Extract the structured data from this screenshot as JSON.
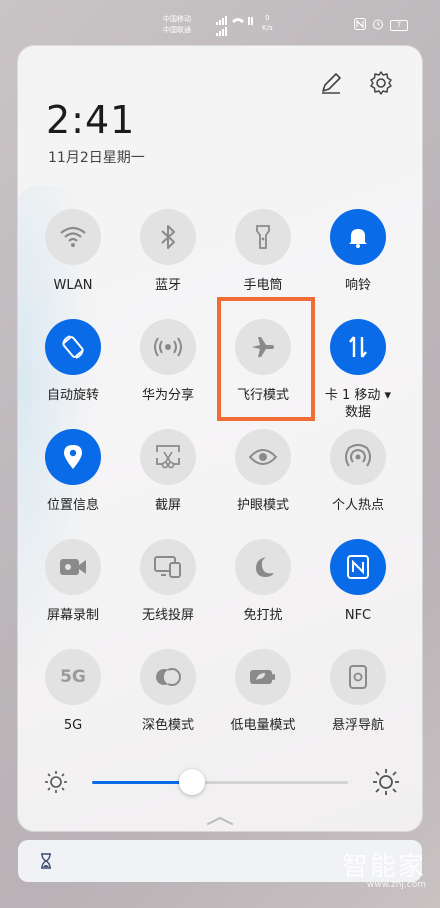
{
  "status_bar": {
    "carrier1": "中国移动",
    "carrier2": "中国联通",
    "speed_value": "0",
    "speed_unit": "K/s",
    "battery": "7"
  },
  "header": {
    "time": "2:41",
    "date": "11月2日星期一"
  },
  "tiles": [
    {
      "label": "WLAN",
      "icon": "wifi-icon",
      "on": false
    },
    {
      "label": "蓝牙",
      "icon": "bluetooth-icon",
      "on": false
    },
    {
      "label": "手电筒",
      "icon": "flashlight-icon",
      "on": false
    },
    {
      "label": "响铃",
      "icon": "bell-icon",
      "on": true
    },
    {
      "label": "自动旋转",
      "icon": "auto-rotate-icon",
      "on": true
    },
    {
      "label": "华为分享",
      "icon": "huawei-share-icon",
      "on": false
    },
    {
      "label": "飞行模式",
      "icon": "airplane-icon",
      "on": false
    },
    {
      "label": "卡 1 移动 ▾",
      "label2": "数据",
      "icon": "mobile-data-icon",
      "on": true
    },
    {
      "label": "位置信息",
      "icon": "location-icon",
      "on": true
    },
    {
      "label": "截屏",
      "icon": "screenshot-icon",
      "on": false
    },
    {
      "label": "护眼模式",
      "icon": "eye-icon",
      "on": false
    },
    {
      "label": "个人热点",
      "icon": "hotspot-icon",
      "on": false
    },
    {
      "label": "屏幕录制",
      "icon": "screen-record-icon",
      "on": false
    },
    {
      "label": "无线投屏",
      "icon": "wireless-projection-icon",
      "on": false
    },
    {
      "label": "免打扰",
      "icon": "moon-icon",
      "on": false
    },
    {
      "label": "NFC",
      "icon": "nfc-icon",
      "on": true
    },
    {
      "label": "5G",
      "icon": "5g-icon",
      "icon_text": "5G",
      "on": false
    },
    {
      "label": "深色模式",
      "icon": "dark-mode-icon",
      "on": false
    },
    {
      "label": "低电量模式",
      "icon": "battery-saver-icon",
      "on": false
    },
    {
      "label": "悬浮导航",
      "icon": "floating-nav-icon",
      "on": false
    }
  ],
  "brightness": {
    "level": 0.39
  },
  "watermark": {
    "text": "智能家",
    "url": "www.znj.com"
  },
  "colors": {
    "accent": "#0a6be8",
    "highlight": "#f06d35",
    "inactive": "#e2e2e3"
  }
}
